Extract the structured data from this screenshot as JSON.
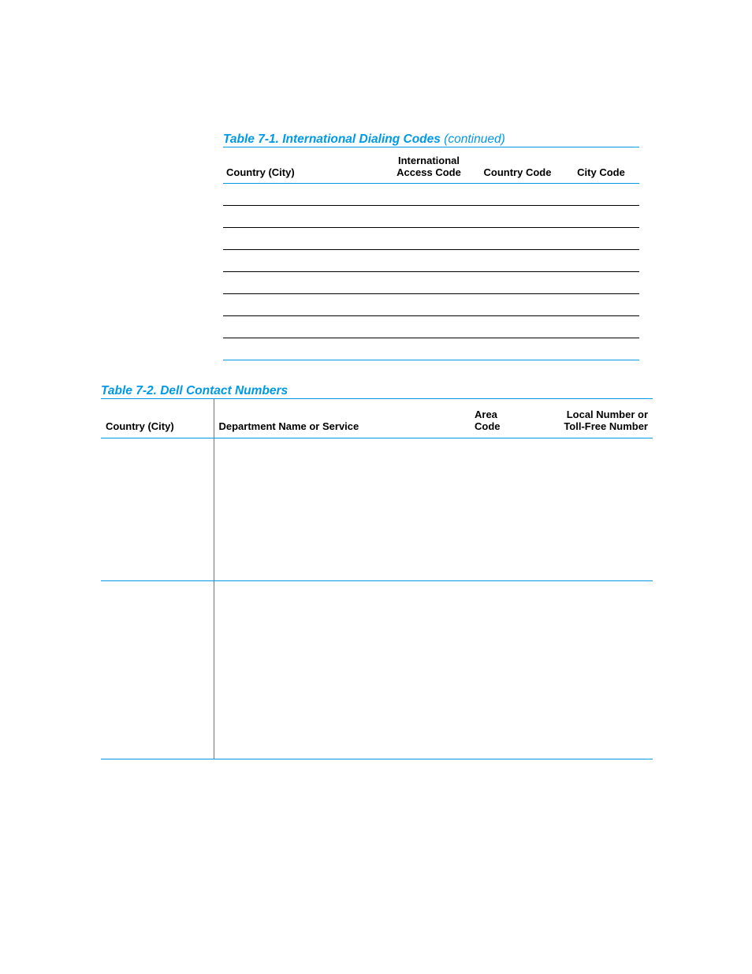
{
  "table1": {
    "caption_prefix": "Table 7-1.  International Dialing Codes ",
    "caption_suffix": "(continued)",
    "headers": {
      "c1": "Country (City)",
      "c2_line1": "International",
      "c2_line2": "Access Code",
      "c3": "Country Code",
      "c4": "City Code"
    },
    "row_count": 8
  },
  "table2": {
    "caption": "Table 7-2.  Dell Contact Numbers",
    "headers": {
      "cA": "Country (City)",
      "cB": "Department Name or Service",
      "cC_line1": "Area",
      "cC_line2": "Code",
      "cD_line1": "Local Number or",
      "cD_line2": "Toll-Free Number"
    }
  }
}
